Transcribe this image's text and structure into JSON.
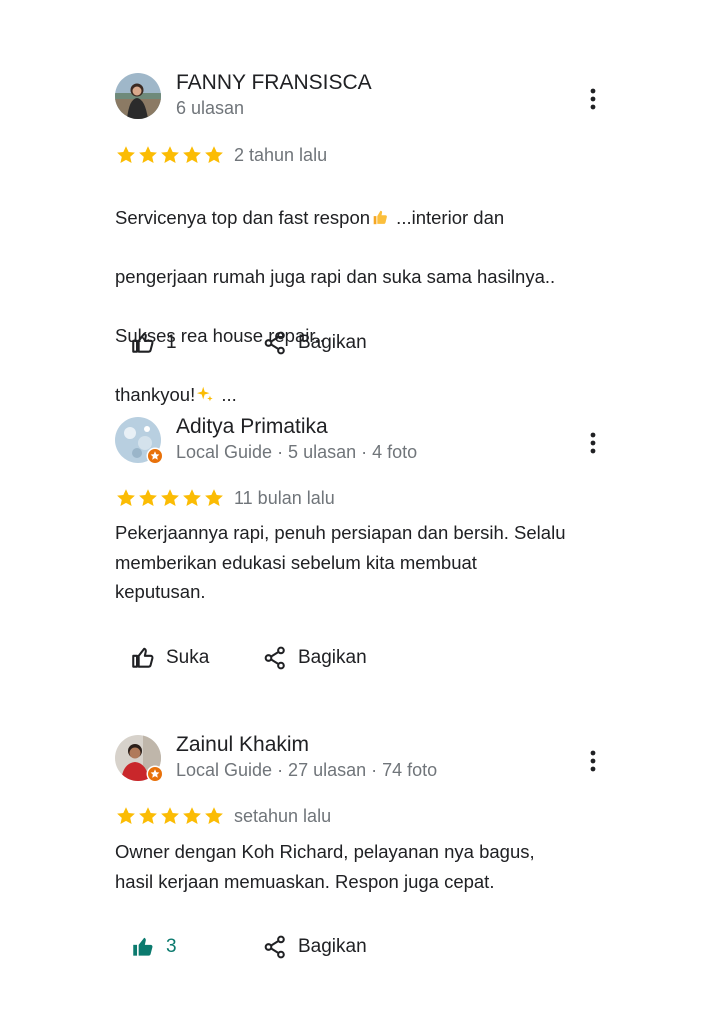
{
  "reviews": [
    {
      "name": "FANNY FRANSISCA",
      "meta": "6 ulasan",
      "time": "2 tahun lalu",
      "text_line1": "Servicenya top dan fast respon",
      "text_line1_rest": " ...interior dan",
      "text_line2": "pengerjaan rumah juga rapi dan suka sama hasilnya..",
      "text_line3": "Sukses rea house repair..",
      "text_line4_a": "thankyou!",
      "text_line4_b": " ...",
      "emoji_1": "thumbs-up-emoji",
      "emoji_2": "sparkles-emoji",
      "like_label": "1",
      "share_label": "Bagikan",
      "rating": 5
    },
    {
      "name": "Aditya Primatika",
      "meta": "Local Guide · 5 ulasan · 4 foto",
      "time": "11 bulan lalu",
      "text": "Pekerjaannya rapi, penuh persiapan dan bersih. Selalu\nmemberikan edukasi sebelum kita membuat\nkeputusan.",
      "like_label": "Suka",
      "share_label": "Bagikan",
      "rating": 5
    },
    {
      "name": "Zainul Khakim",
      "meta": "Local Guide · 27 ulasan · 74 foto",
      "time": "setahun lalu",
      "text": "Owner dengan Koh Richard, pelayanan nya bagus,\nhasil kerjaan memuaskan. Respon juga cepat.",
      "like_label": "3",
      "share_label": "Bagikan",
      "rating": 5,
      "liked": true
    }
  ],
  "colors": {
    "star": "#fbbc04",
    "text": "#202124",
    "muted": "#70757a",
    "liked": "#0b7a6e",
    "guide_badge": "#e8710a"
  }
}
